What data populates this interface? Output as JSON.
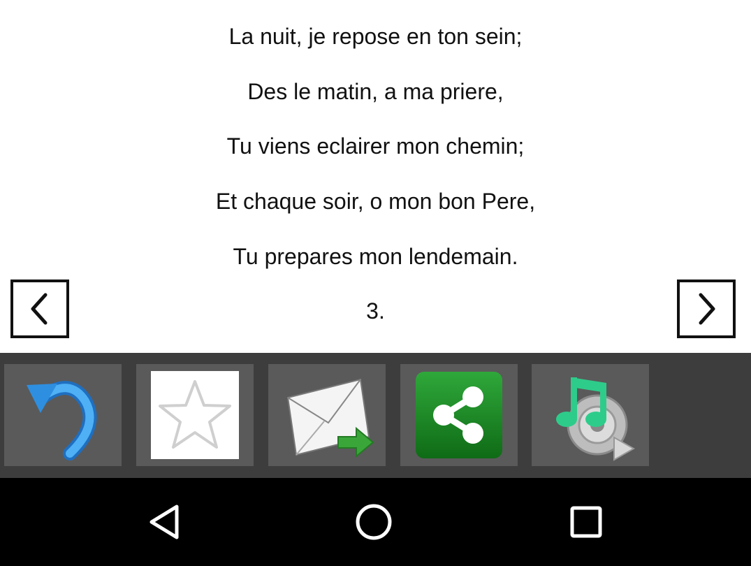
{
  "verse": {
    "lines": [
      "La nuit, je repose en ton sein;",
      "Des le matin, a ma priere,",
      "Tu viens eclairer mon chemin;",
      "Et chaque soir, o mon bon Pere,",
      "Tu prepares mon lendemain.",
      "3."
    ]
  },
  "nav": {
    "prev_icon": "chevron-left-icon",
    "next_icon": "chevron-right-icon"
  },
  "toolbar": {
    "buttons": [
      {
        "icon": "undo-arrow-icon",
        "color": "#2e8fe0"
      },
      {
        "icon": "star-outline-icon",
        "color": "#cccccc"
      },
      {
        "icon": "email-forward-icon",
        "color": "#3aa63a"
      },
      {
        "icon": "share-icon",
        "color": "#1f8f2a"
      },
      {
        "icon": "music-speaker-icon",
        "color": "#2ecc8a"
      }
    ]
  },
  "system_nav": {
    "buttons": [
      "back-triangle-icon",
      "home-circle-icon",
      "recents-square-icon"
    ]
  }
}
